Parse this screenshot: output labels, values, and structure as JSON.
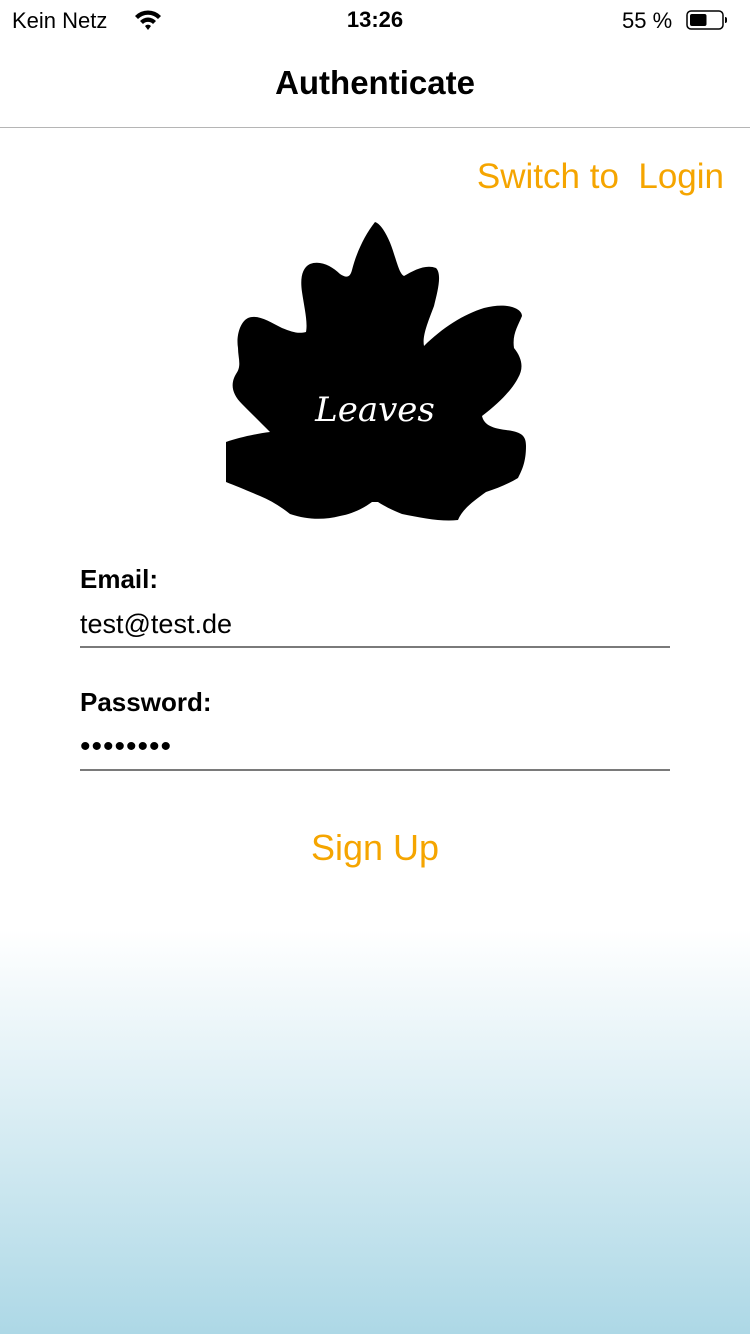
{
  "status_bar": {
    "carrier": "Kein Netz",
    "wifi_icon": "wifi-icon",
    "time": "13:26",
    "battery_percent": "55 %",
    "battery_icon": "battery-icon",
    "battery_level": 0.55
  },
  "nav": {
    "title": "Authenticate"
  },
  "switch_link": {
    "label": "Switch to  Login"
  },
  "logo": {
    "icon": "maple-leaf-logo",
    "text": "Leaves"
  },
  "form": {
    "email_label": "Email:",
    "email_value": "test@test.de",
    "password_label": "Password:",
    "password_value": "••••••••"
  },
  "submit": {
    "label": "Sign Up"
  },
  "colors": {
    "accent": "#f5a500",
    "gradient_bottom": "#add8e6"
  }
}
